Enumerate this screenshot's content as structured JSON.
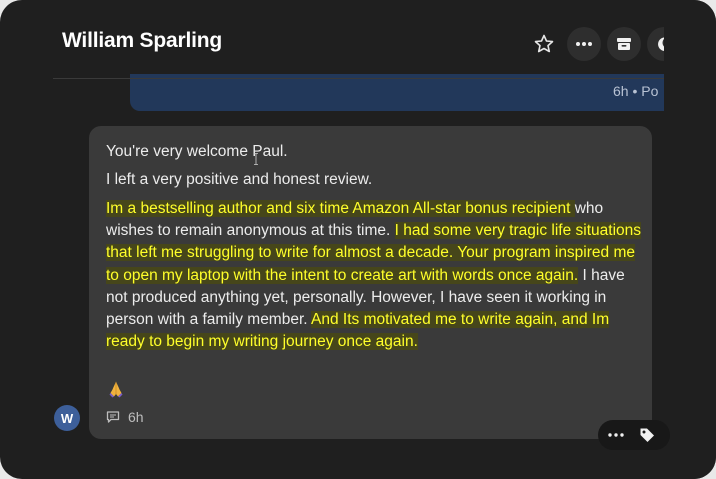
{
  "header": {
    "title": "William Sparling",
    "icons": [
      "star-icon",
      "more-icon",
      "archive-icon",
      "moon-icon"
    ]
  },
  "previous_message": {
    "meta": "6h • Po"
  },
  "message": {
    "line1": "You're very welcome Paul.",
    "line2": "I left a very positive and honest review.",
    "segments": [
      {
        "text": "Im a bestselling author and six time Amazon All-star bonus recipient ",
        "highlight": true
      },
      {
        "text": "who wishes to remain anonymous at this time. ",
        "highlight": false
      },
      {
        "text": "I had some very tragic life situations that left me struggling to write for almost a decade. Your program inspired me to open my laptop with the intent to create art with words once again.",
        "highlight": true
      },
      {
        "text": " I have not produced anything yet, personally. However, I have seen it working in person with a family member. ",
        "highlight": false
      },
      {
        "text": "And Its motivated me to write again, and Im ready to begin my writing journey once again. ",
        "highlight": true
      }
    ],
    "emoji": "folded-hands-icon",
    "time": "6h",
    "avatar_initial": "W"
  },
  "colors": {
    "highlight_text": "#ffff2a",
    "bubble": "#3a3a3a",
    "avatar": "#3d5f9a",
    "background": "#1f1f1f"
  }
}
